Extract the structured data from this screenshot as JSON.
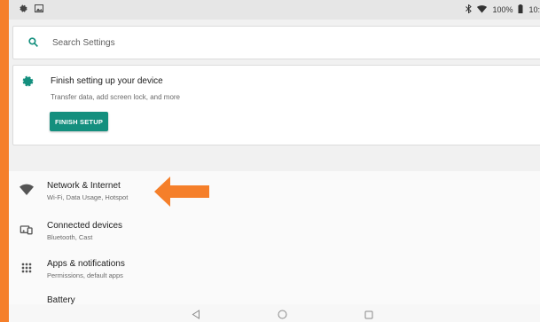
{
  "status_bar": {
    "left_icons": [
      "gear-icon",
      "image-icon"
    ],
    "right_icons": [
      "bluetooth-icon",
      "wifi-icon"
    ],
    "battery": "100%",
    "time": "10:"
  },
  "search": {
    "placeholder": "Search Settings"
  },
  "setup_card": {
    "title": "Finish setting up your device",
    "subtitle": "Transfer data, add screen lock, and more",
    "button_label": "FINISH SETUP",
    "button_color": "#148f7e"
  },
  "settings": [
    {
      "icon": "wifi-icon",
      "title": "Network & Internet",
      "subtitle": "Wi-Fi, Data Usage, Hotspot"
    },
    {
      "icon": "devices-icon",
      "title": "Connected devices",
      "subtitle": "Bluetooth, Cast"
    },
    {
      "icon": "apps-grid-icon",
      "title": "Apps & notifications",
      "subtitle": "Permissions, default apps"
    },
    {
      "icon": "battery-icon",
      "title": "Battery",
      "subtitle": ""
    }
  ],
  "annotation": {
    "color": "#f57f2a"
  },
  "nav_bar": [
    "back-icon",
    "home-icon",
    "recents-icon"
  ]
}
